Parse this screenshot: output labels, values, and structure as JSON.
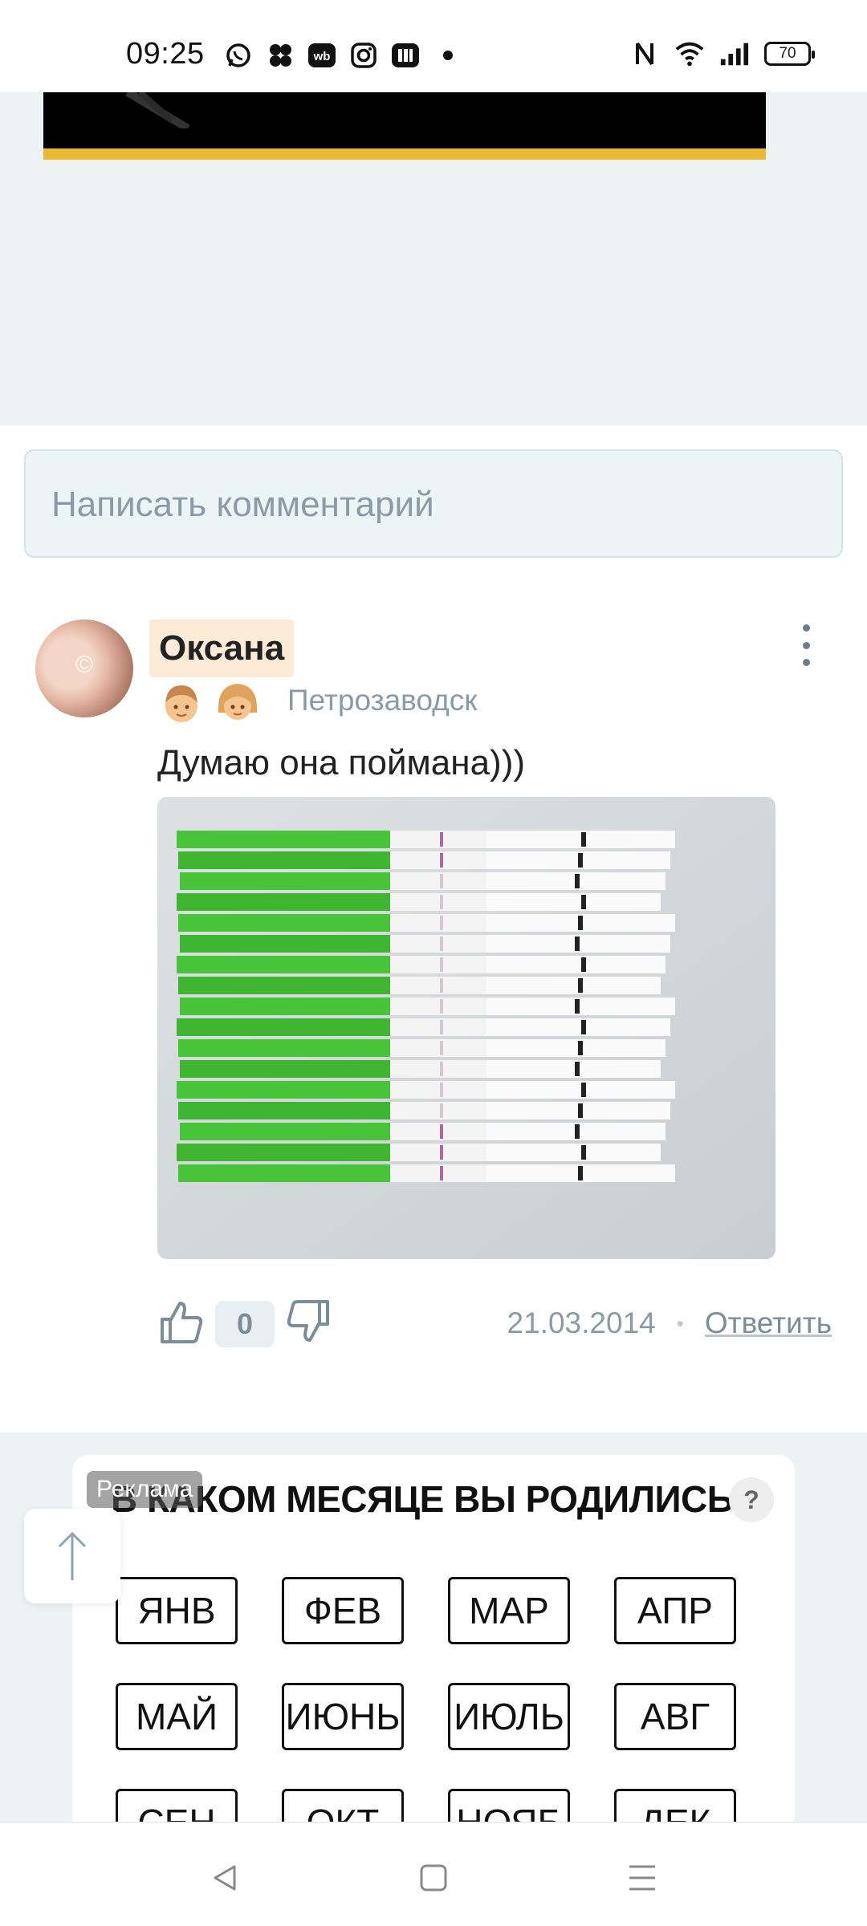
{
  "status_bar": {
    "time": "09:25",
    "battery": "70",
    "left_icons": [
      "whatsapp-icon",
      "flower-app-icon",
      "wb-app-icon",
      "instagram-icon",
      "book-app-icon",
      "dot-icon"
    ],
    "right_icons": [
      "nfc-icon",
      "wifi-icon",
      "signal-icon",
      "battery-icon"
    ],
    "wb_label": "wb"
  },
  "comment_input": {
    "placeholder": "Написать комментарий"
  },
  "comment": {
    "author": "Оксана",
    "city": "Петрозаводск",
    "text": "Думаю она поймана)))",
    "likes": "0",
    "date": "21.03.2014",
    "separator": "•",
    "reply_label": "Ответить",
    "badges": [
      "boy-badge-icon",
      "girl-badge-icon"
    ]
  },
  "ad": {
    "label": "Реклама",
    "title": "В КАКОМ МЕСЯЦЕ ВЫ РОДИЛИСЬ?",
    "close": "?",
    "months": [
      "ЯНВ",
      "ФЕВ",
      "МАР",
      "АПР",
      "МАЙ",
      "ИЮНЬ",
      "ИЮЛЬ",
      "АВГ",
      "СЕН",
      "ОКТ",
      "НОЯБ",
      "ДЕК"
    ]
  },
  "colors": {
    "page_bg": "#edf3f5",
    "accent_bar": "#e9b934",
    "author_highlight": "#fdebd7",
    "muted_text": "#8a9aa6"
  }
}
